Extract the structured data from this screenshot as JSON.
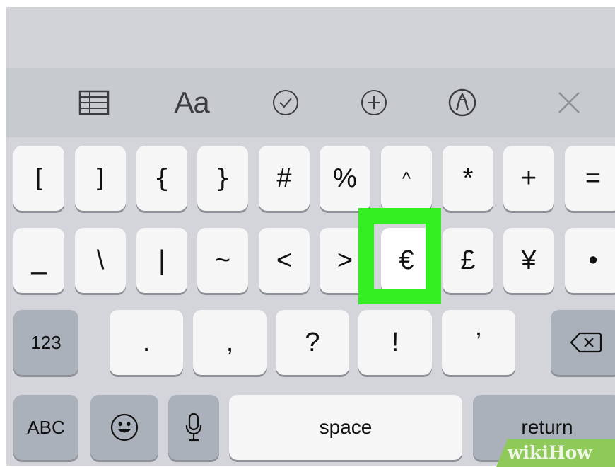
{
  "toolbar": {
    "items": [
      {
        "icon": "table-icon"
      },
      {
        "label": "Aa"
      },
      {
        "icon": "checkmark-circle-icon"
      },
      {
        "icon": "plus-circle-icon"
      },
      {
        "icon": "markup-pen-icon"
      },
      {
        "icon": "close-icon"
      }
    ]
  },
  "keyboard": {
    "row1": [
      "[",
      "]",
      "{",
      "}",
      "#",
      "%",
      "^",
      "*",
      "+",
      "="
    ],
    "row2": [
      "_",
      "\\",
      "|",
      "~",
      "<",
      ">",
      "€",
      "£",
      "¥",
      "•"
    ],
    "row3": {
      "mode_key": "123",
      "keys": [
        ".",
        ",",
        "?",
        "!",
        "’"
      ],
      "delete_icon": "backspace-icon"
    },
    "row4": {
      "abc": "ABC",
      "emoji_icon": "emoji-icon",
      "mic_icon": "microphone-icon",
      "space": "space",
      "return": "return"
    },
    "highlighted_key": "€",
    "highlight_color": "#33ee21"
  },
  "watermark": {
    "text_a": "wiki",
    "text_b": "How"
  }
}
